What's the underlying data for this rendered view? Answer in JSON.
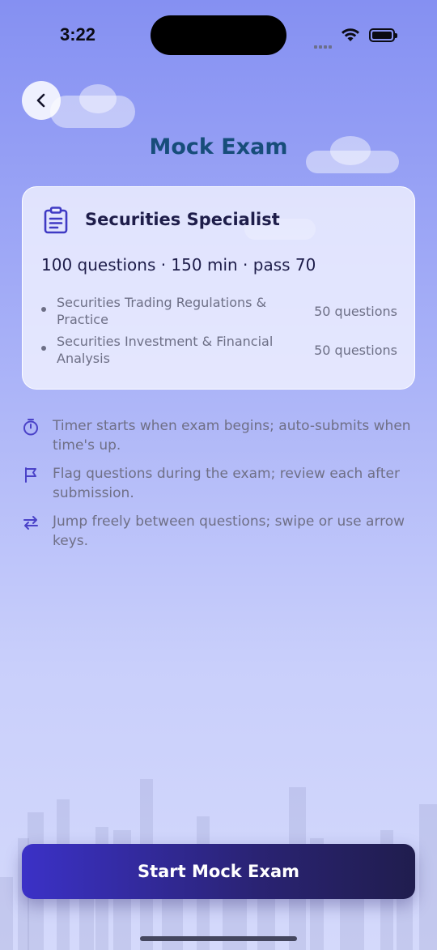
{
  "status_bar": {
    "time": "3:22"
  },
  "header": {
    "title": "Mock Exam",
    "back_icon": "chevron-left-icon"
  },
  "card": {
    "icon": "clipboard-icon",
    "title": "Securities Specialist",
    "meta": "100 questions · 150 min · pass 70",
    "sections": [
      {
        "name": "Securities Trading Regulations & Practice",
        "count": "50 questions"
      },
      {
        "name": "Securities Investment & Financial Analysis",
        "count": "50 questions"
      }
    ]
  },
  "tips": [
    {
      "icon": "stopwatch-icon",
      "text": "Timer starts when exam begins; auto-submits when time's up."
    },
    {
      "icon": "flag-icon",
      "text": "Flag questions during the exam; review each after submission."
    },
    {
      "icon": "arrows-swap-icon",
      "text": "Jump freely between questions; swipe or use arrow keys."
    }
  ],
  "actions": {
    "start_label": "Start Mock Exam"
  },
  "colors": {
    "accent": "#3f3ac4",
    "title": "#174d7a",
    "button_start": "#3b31c7",
    "button_end": "#201d4e"
  }
}
